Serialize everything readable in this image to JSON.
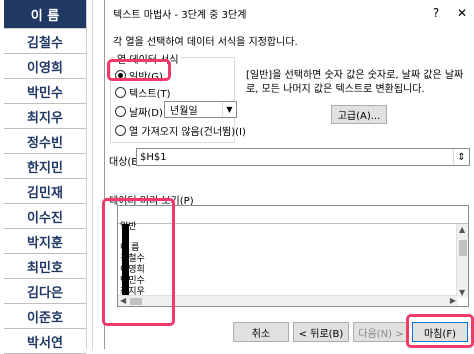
{
  "sheet": {
    "header": "이 름",
    "names": [
      "김철수",
      "이영희",
      "박민수",
      "최지우",
      "정수빈",
      "한지민",
      "김민재",
      "이수진",
      "박지훈",
      "최민호",
      "김다은",
      "이준호",
      "박서연"
    ]
  },
  "dialog": {
    "title": "텍스트 마법사 - 3단계 중 3단계",
    "help": "?",
    "close": "✕",
    "instruction": "각 열을 선택하여 데이터 서식을 지정합니다.",
    "group_label": "열 데이터 서식",
    "options": {
      "general": "일반(G)",
      "text": "텍스트(T)",
      "date": "날짜(D):",
      "skip": "열 가져오지 않음(건너뜀)(I)"
    },
    "date_format": "년월일",
    "description": "[일반]을 선택하면 숫자 값은 숫자로, 날짜 값은 날짜로, 모든 나머지 값은 텍스트로 변환됩니다.",
    "advanced_button": "고급(A)...",
    "target_label": "대상(E):",
    "target_value": "$H$1",
    "preview_label": "데이터 미리 보기(P)",
    "preview": {
      "column_header": "일반",
      "rows": [
        "이 름",
        "김철수",
        "이영희",
        "박민수",
        "최지우"
      ]
    },
    "buttons": {
      "cancel": "취소",
      "back": "< 뒤로(B)",
      "next": "다음(N) >",
      "finish": "마침(F)"
    }
  },
  "colors": {
    "header_bg": "#1f3864",
    "name_text": "#1f3864",
    "highlight": "#f03a6a"
  }
}
